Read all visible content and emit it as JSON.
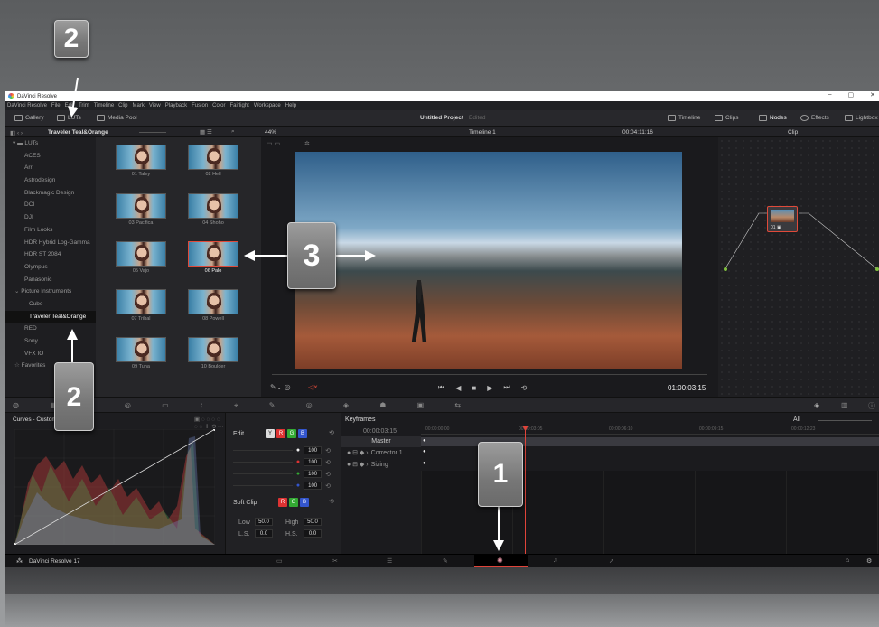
{
  "window": {
    "title": "DaVinci Resolve",
    "controls": [
      "–",
      "▢",
      "✕"
    ]
  },
  "menu": [
    "DaVinci Resolve",
    "File",
    "Edit",
    "Trim",
    "Timeline",
    "Clip",
    "Mark",
    "View",
    "Playback",
    "Fusion",
    "Color",
    "Fairlight",
    "Workspace",
    "Help"
  ],
  "toolbar": {
    "gallery": "Gallery",
    "luts": "LUTs",
    "media_pool": "Media Pool",
    "project_title": "Untitled Project",
    "project_status": "Edited",
    "timeline_btn": "Timeline",
    "clips_btn": "Clips",
    "nodes_btn": "Nodes",
    "effects_btn": "Effects",
    "lightbox_btn": "Lightbox"
  },
  "subbar": {
    "lut_folder": "Traveler Teal&Orange",
    "zoom": "44%",
    "timeline_name": "Timeline 1",
    "timecode": "00:04:11:16",
    "clip_mode": "Clip"
  },
  "sidebar": {
    "root": "LUTs",
    "items": [
      "ACES",
      "Arri",
      "Astrodesign",
      "Blackmagic Design",
      "DCI",
      "DJI",
      "Film Looks",
      "HDR Hybrid Log-Gamma",
      "HDR ST 2084",
      "Olympus",
      "Panasonic",
      "Picture Instruments",
      "Cube",
      "Traveler Teal&Orange",
      "RED",
      "Sony",
      "VFX IO",
      "Favorites"
    ],
    "selected": "Traveler Teal&Orange"
  },
  "luts": [
    {
      "label": "01 Taley"
    },
    {
      "label": "02 Hell"
    },
    {
      "label": "03 Pacifica"
    },
    {
      "label": "04 Shoho"
    },
    {
      "label": "05 Vajo"
    },
    {
      "label": "06 Palo"
    },
    {
      "label": "07 Tribal"
    },
    {
      "label": "08 Powell"
    },
    {
      "label": "09 Tuna"
    },
    {
      "label": "10 Boulder"
    }
  ],
  "selected_lut": "06 Palo",
  "viewer": {
    "timecode": "01:00:03:15"
  },
  "curves": {
    "title": "Curves - Custom"
  },
  "edit_panel": {
    "edit_label": "Edit",
    "channels": [
      "Y",
      "R",
      "G",
      "B"
    ],
    "values": [
      "100",
      "100",
      "100",
      "100",
      "100"
    ],
    "soft_clip_label": "Soft Clip",
    "low_label": "Low",
    "low_value": "50.0",
    "high_label": "High",
    "high_value": "50.0",
    "ls_label": "L.S.",
    "ls_value": "0.0",
    "hs_label": "H.S.",
    "hs_value": "0.0"
  },
  "keyframes": {
    "title": "Keyframes",
    "filter": "All",
    "current_tc": "00:00:03:15",
    "ruler": [
      "00:00:00:00",
      "00:00:03:05",
      "00:00:06:10",
      "00:00:09:15",
      "00:00:12:23"
    ],
    "tracks": [
      "Master",
      "Corrector 1",
      "Sizing"
    ]
  },
  "pagebar": {
    "app_name": "DaVinci Resolve 17"
  },
  "callouts": [
    "2",
    "3",
    "2",
    "1"
  ]
}
